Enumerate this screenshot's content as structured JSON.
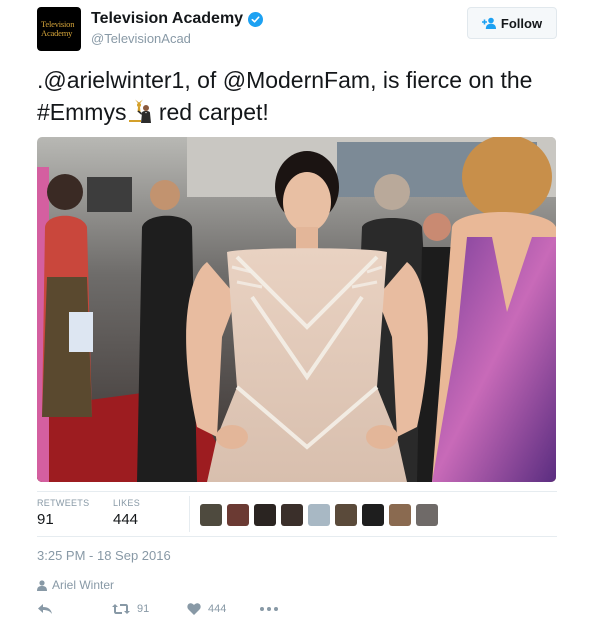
{
  "account": {
    "avatar_text_line1": "Television",
    "avatar_text_line2": "Academy",
    "display_name": "Television Academy",
    "handle": "@TelevisionAcad",
    "verified": true
  },
  "follow_button": {
    "label": "Follow"
  },
  "tweet": {
    "prefix": ".",
    "mention1": "@arielwinter1",
    "text1": ", of ",
    "mention2": "@ModernFam",
    "text2": ", is fierce on the ",
    "hashtag": "#Emmys",
    "text3": " red carpet!",
    "emoji": "emmy-statuette-emoji"
  },
  "stats": {
    "retweets_label": "RETWEETS",
    "retweets_value": "91",
    "likes_label": "LIKES",
    "likes_value": "444",
    "liker_avatars_count": 9
  },
  "timestamp": "3:25 PM - 18 Sep 2016",
  "context_user": "Ariel Winter",
  "actions": {
    "reply_icon": "reply-icon",
    "retweet_count": "91",
    "like_count": "444",
    "more_icon": "more-icon"
  },
  "colors": {
    "verified_blue": "#1da1f2",
    "muted_text": "#8899a6",
    "border": "#e6ecf0"
  }
}
